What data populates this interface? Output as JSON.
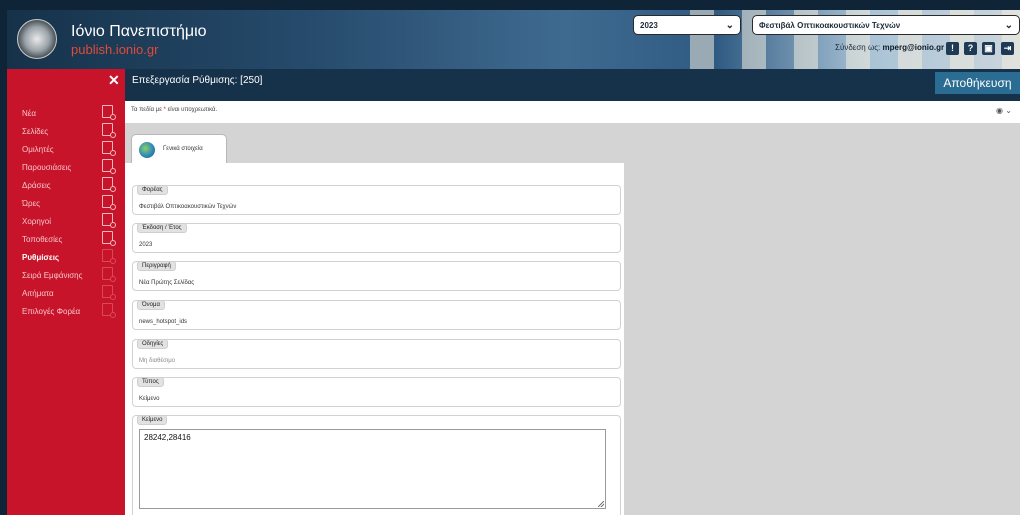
{
  "header": {
    "university_name": "Ιόνιο Πανεπιστήμιο",
    "site_url": "publish.ionio.gr",
    "year_select": "2023",
    "entity_select": "Φεστιβάλ Οπτικοακουστικών Τεχνών",
    "login_prefix": "Σύνδεση ως:",
    "login_user": "mperg@ionio.gr",
    "icons": [
      "alert-icon",
      "help-icon",
      "lock-icon",
      "logout-icon"
    ]
  },
  "sidebar": {
    "items": [
      {
        "label": "Νέα",
        "active": false
      },
      {
        "label": "Σελίδες",
        "active": false
      },
      {
        "label": "Ομιλητές",
        "active": false
      },
      {
        "label": "Παρουσιάσεις",
        "active": false
      },
      {
        "label": "Δράσεις",
        "active": false
      },
      {
        "label": "Ώρες",
        "active": false
      },
      {
        "label": "Χορηγοί",
        "active": false
      },
      {
        "label": "Τοποθεσίες",
        "active": false
      },
      {
        "label": "Ρυθμίσεις",
        "active": true
      },
      {
        "label": "Σειρά Εμφάνισης",
        "active": false
      },
      {
        "label": "Αιτήματα",
        "active": false
      },
      {
        "label": "Επιλογές Φορέα",
        "active": false
      }
    ]
  },
  "topbar": {
    "title": "Επεξεργασία Ρύθμισης: [250]",
    "save_label": "Αποθήκευση"
  },
  "required_note": {
    "prefix": "Τα πεδία με",
    "star": "*",
    "suffix": "είναι υποχρεωτικά."
  },
  "tab": {
    "label": "Γενικά στοιχεία"
  },
  "fields": [
    {
      "label": "Φορέας",
      "value": "Φεστιβάλ Οπτικοακουστικών Τεχνών"
    },
    {
      "label": "Έκδοση / Έτος",
      "value": "2023"
    },
    {
      "label": "Περιγραφή",
      "value": "Νέα Πρώτης Σελίδας"
    },
    {
      "label": "Όνομα",
      "value": "news_hotspot_ids"
    },
    {
      "label": "Οδηγίες",
      "value": "Μη διαθέσιμο"
    },
    {
      "label": "Τύπος",
      "value": "Κείμενο"
    },
    {
      "label": "Κείμενο",
      "value": "28242,28416"
    }
  ],
  "colors": {
    "sidebar": "#c8142a",
    "topbar": "#16324a",
    "save_button": "#2b6c93",
    "url_accent": "#e24a3a"
  }
}
